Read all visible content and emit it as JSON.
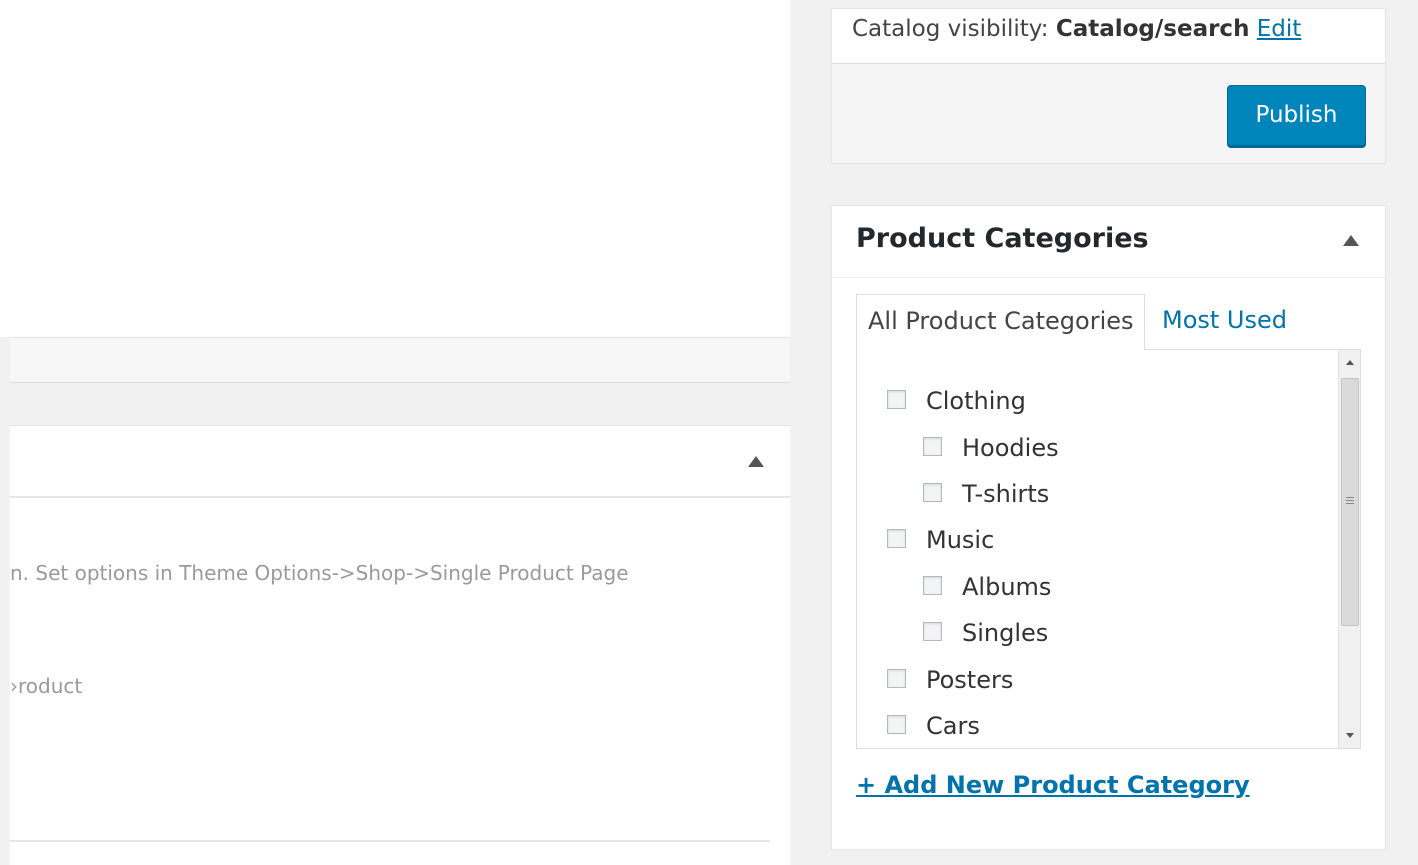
{
  "publish": {
    "catalog_label": "Catalog visibility:",
    "catalog_value": "Catalog/search",
    "edit_label": "Edit",
    "publish_label": "Publish"
  },
  "categories_box": {
    "title": "Product Categories",
    "tabs": [
      {
        "label": "All Product Categories",
        "active": true
      },
      {
        "label": "Most Used",
        "active": false
      }
    ],
    "items": [
      {
        "label": "Clothing",
        "level": 0,
        "checked": false
      },
      {
        "label": "Hoodies",
        "level": 1,
        "checked": false
      },
      {
        "label": "T-shirts",
        "level": 1,
        "checked": false
      },
      {
        "label": "Music",
        "level": 0,
        "checked": false
      },
      {
        "label": "Albums",
        "level": 1,
        "checked": false
      },
      {
        "label": "Singles",
        "level": 1,
        "checked": false
      },
      {
        "label": "Posters",
        "level": 0,
        "checked": false
      },
      {
        "label": "Cars",
        "level": 0,
        "checked": false
      }
    ],
    "add_new_label": "+ Add New Product Category"
  },
  "main": {
    "note_text": "n. Set options in Theme Options->Shop->Single Product Page",
    "partial_text": "›roduct"
  },
  "colors": {
    "accent": "#0073aa",
    "button": "#0085ba",
    "background": "#f1f1f1"
  },
  "icons": [
    "collapse-arrow-icon",
    "checkbox-icon",
    "scrollbar-up-icon",
    "scrollbar-down-icon"
  ]
}
